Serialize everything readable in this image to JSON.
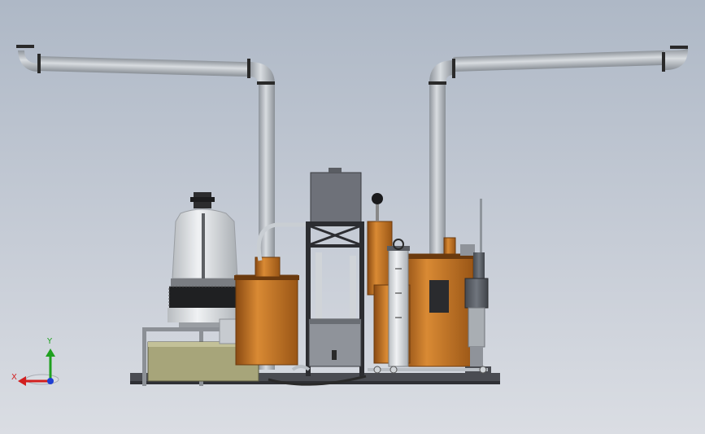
{
  "viewport": {
    "background_top": "#aeb8c6",
    "background_bottom": "#dadde3"
  },
  "colors": {
    "pipe": "#b9bec4",
    "pipe_shade": "#8f959c",
    "tank_orange": "#c8741f",
    "tank_orange_dark": "#8a4a12",
    "frame": "#3a3a3e",
    "cooling_tower": "#e4e6e8",
    "dark_tank": "#5d616a",
    "basin": "#a7a57a"
  },
  "triad": {
    "x_label": "X",
    "y_label": "Y",
    "x_color": "#d21f1f",
    "y_color": "#1fa01f",
    "z_color": "#1f3fd2"
  },
  "components": [
    "left-exhaust-pipe",
    "right-exhaust-pipe",
    "cooling-tower",
    "water-basin",
    "left-orange-tank",
    "center-frame",
    "control-box",
    "right-orange-tank",
    "filter-column",
    "pump-motor",
    "base-skid"
  ]
}
